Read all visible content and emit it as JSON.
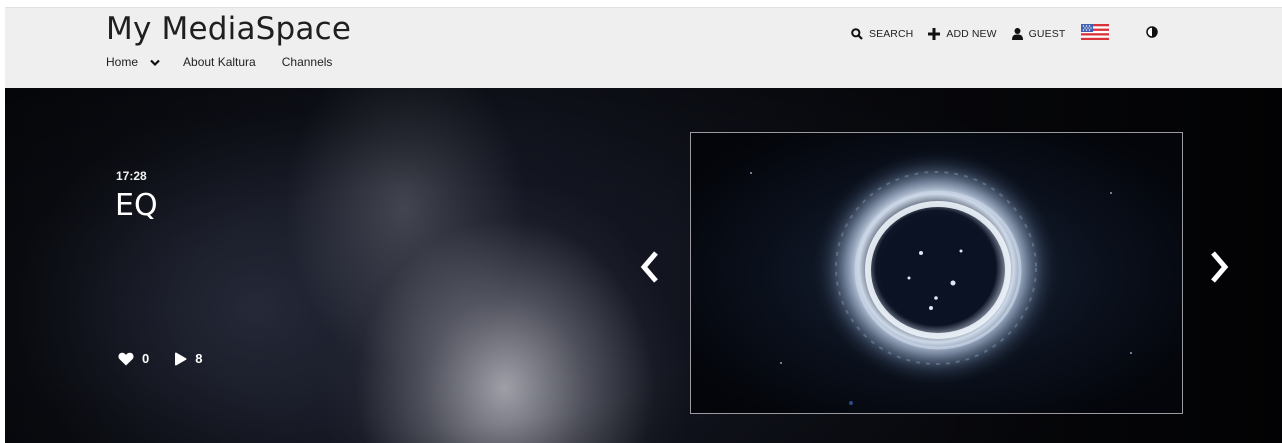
{
  "header": {
    "site_title": "My MediaSpace",
    "nav": {
      "home": "Home",
      "about": "About Kaltura",
      "channels": "Channels"
    },
    "actions": {
      "search": "SEARCH",
      "add_new": "ADD NEW",
      "guest": "GUEST"
    },
    "icons": [
      "search-icon",
      "plus-icon",
      "user-icon",
      "us-flag-icon",
      "contrast-icon"
    ]
  },
  "hero": {
    "duration": "17:28",
    "title": "EQ",
    "likes": "0",
    "plays": "8",
    "icons": [
      "heart-icon",
      "play-icon",
      "chevron-left-icon",
      "chevron-right-icon"
    ]
  },
  "colors": {
    "header_bg": "#efefef",
    "hero_bg": "#0b0c12",
    "text_dark": "#1f1f1f",
    "text_light": "#ffffff"
  }
}
